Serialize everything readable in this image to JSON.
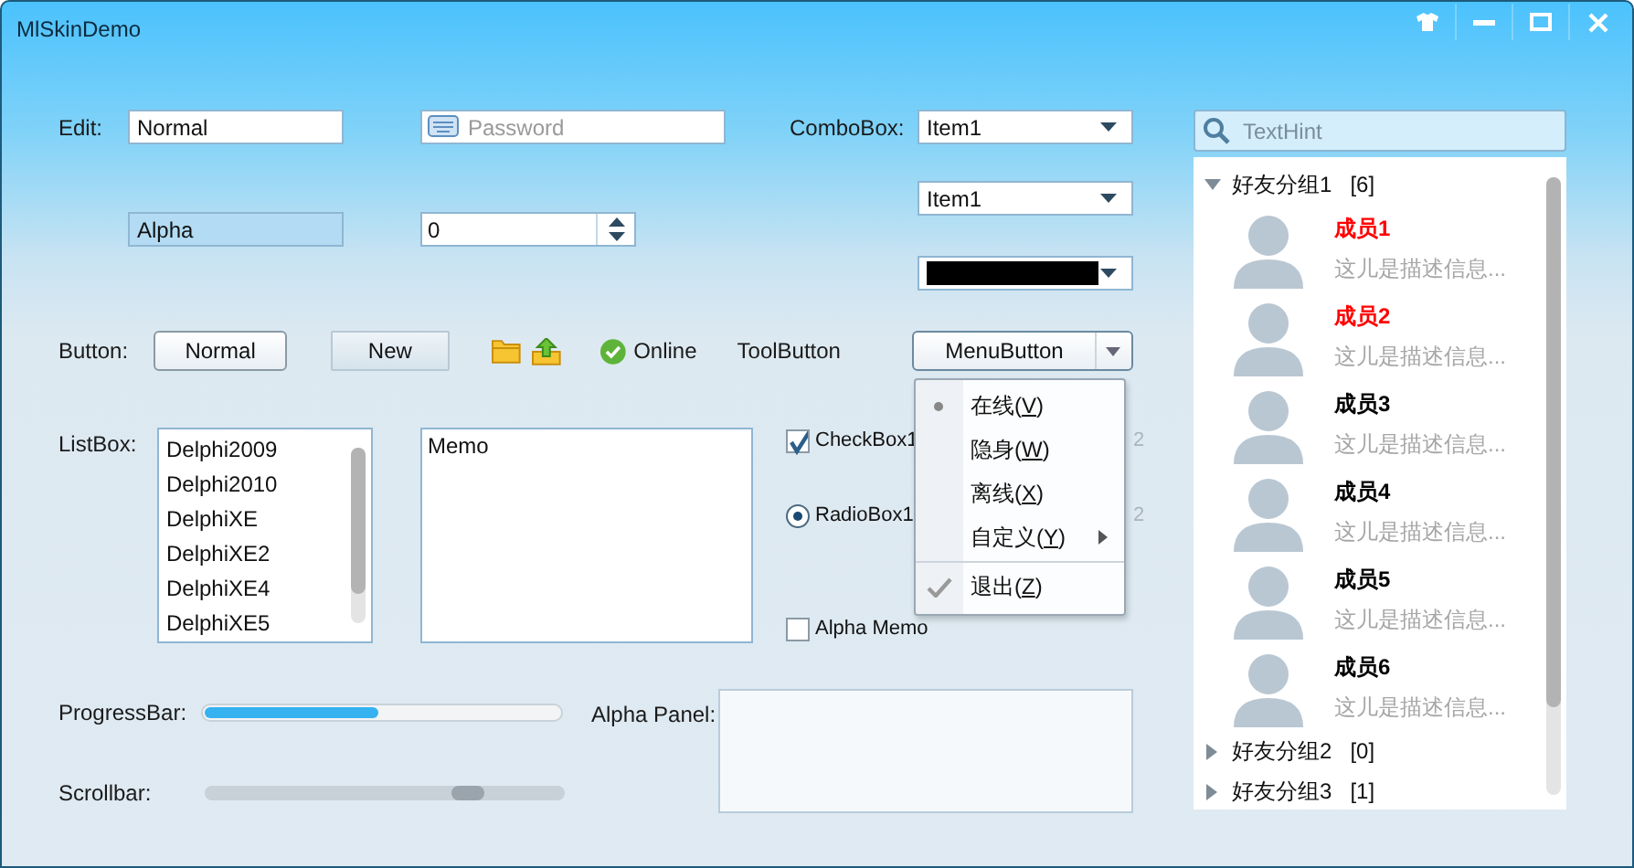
{
  "window": {
    "title": "MlSkinDemo"
  },
  "edit": {
    "label": "Edit:",
    "value": "Normal"
  },
  "password": {
    "placeholder": "Password"
  },
  "alpha_edit": {
    "value": "Alpha"
  },
  "spin": {
    "value": "0"
  },
  "combobox": {
    "label": "ComboBox:",
    "value": "Item1"
  },
  "combobox_2": {
    "value": "Item1"
  },
  "buttons": {
    "label": "Button:",
    "items": [
      {
        "label": "Normal",
        "kind": "normal"
      },
      {
        "label": "New",
        "kind": "flat"
      }
    ]
  },
  "status": {
    "label": "Online"
  },
  "tool_button": {
    "label": "ToolButton"
  },
  "menu_button": {
    "label": "MenuButton",
    "expanded": true
  },
  "menu": [
    {
      "before": "在线(",
      "key": "V",
      "after": ")",
      "bullet": true,
      "checked": false,
      "submenu": false,
      "separator_before": false
    },
    {
      "before": "隐身(",
      "key": "W",
      "after": ")",
      "bullet": false,
      "checked": false,
      "submenu": false,
      "separator_before": false
    },
    {
      "before": "离线(",
      "key": "X",
      "after": ")",
      "bullet": false,
      "checked": false,
      "submenu": false,
      "separator_before": false
    },
    {
      "before": "自定义(",
      "key": "Y",
      "after": ")",
      "bullet": false,
      "checked": false,
      "submenu": true,
      "separator_before": false
    },
    {
      "before": "退出(",
      "key": "Z",
      "after": ")",
      "bullet": false,
      "checked": true,
      "submenu": false,
      "separator_before": true
    }
  ],
  "listbox": {
    "label": "ListBox:",
    "items": [
      "Delphi2009",
      "Delphi2010",
      "DelphiXE",
      "DelphiXE2",
      "DelphiXE4",
      "DelphiXE5"
    ]
  },
  "memo": {
    "value": "Memo"
  },
  "checkbox": {
    "label": "CheckBox1",
    "checked": true
  },
  "covered_checkbox": {
    "label": "2"
  },
  "radio": {
    "label": "RadioBox1",
    "selected": true
  },
  "covered_radio": {
    "label": "2"
  },
  "alpha_memo": {
    "label": "Alpha Memo",
    "checked": false
  },
  "progress": {
    "label": "ProgressBar:",
    "level": 0.49
  },
  "scrollbar": {
    "label": "Scrollbar:"
  },
  "alpha_panel": {
    "label": "Alpha Panel:"
  },
  "search": {
    "placeholder": "TextHint"
  },
  "tree": [
    {
      "name": "好友分组1",
      "count": "[6]",
      "expanded": true,
      "children": [
        {
          "name": "成员1",
          "color": "#ff0000",
          "description": "这儿是描述信息..."
        },
        {
          "name": "成员2",
          "color": "#ff0000",
          "description": "这儿是描述信息..."
        },
        {
          "name": "成员3",
          "color": "#000000",
          "description": "这儿是描述信息..."
        },
        {
          "name": "成员4",
          "color": "#000000",
          "description": "这儿是描述信息..."
        },
        {
          "name": "成员5",
          "color": "#000000",
          "description": "这儿是描述信息..."
        },
        {
          "name": "成员6",
          "color": "#000000",
          "description": "这儿是描述信息..."
        }
      ]
    },
    {
      "name": "好友分组2",
      "count": "[0]",
      "expanded": false
    },
    {
      "name": "好友分组3",
      "count": "[1]",
      "expanded": false
    }
  ]
}
